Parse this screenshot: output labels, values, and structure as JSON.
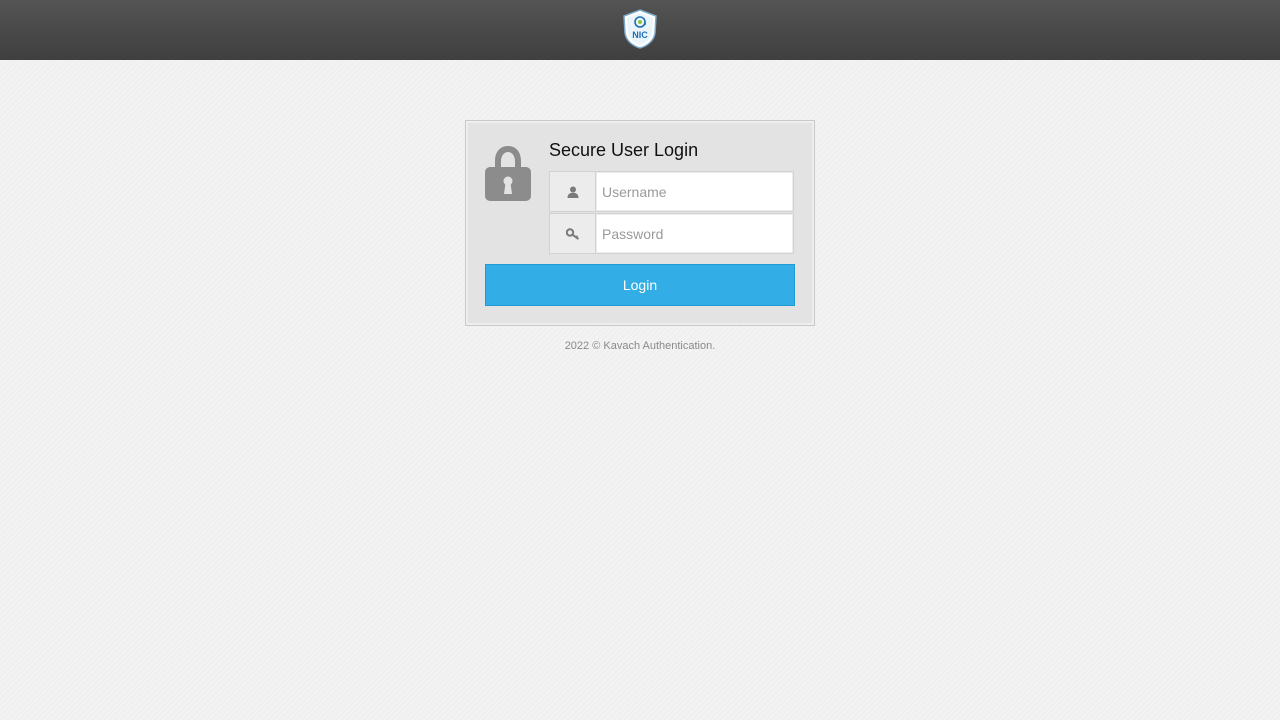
{
  "header": {
    "logo": {
      "icon": "nic-shield-logo",
      "text": "NIC",
      "at_symbol": "@"
    }
  },
  "login": {
    "title": "Secure User Login",
    "lock_icon": "padlock-icon",
    "username": {
      "icon": "user-icon",
      "value": "",
      "placeholder": "Username"
    },
    "password": {
      "icon": "key-icon",
      "value": "",
      "placeholder": "Password"
    },
    "submit_label": "Login"
  },
  "footer": {
    "copyright": "2022 © Kavach Authentication."
  },
  "colors": {
    "topbar": "#4a4a4a",
    "panel_bg": "#e3e3e3",
    "button": "#32ade6",
    "icon_gray": "#8c8c8c"
  }
}
